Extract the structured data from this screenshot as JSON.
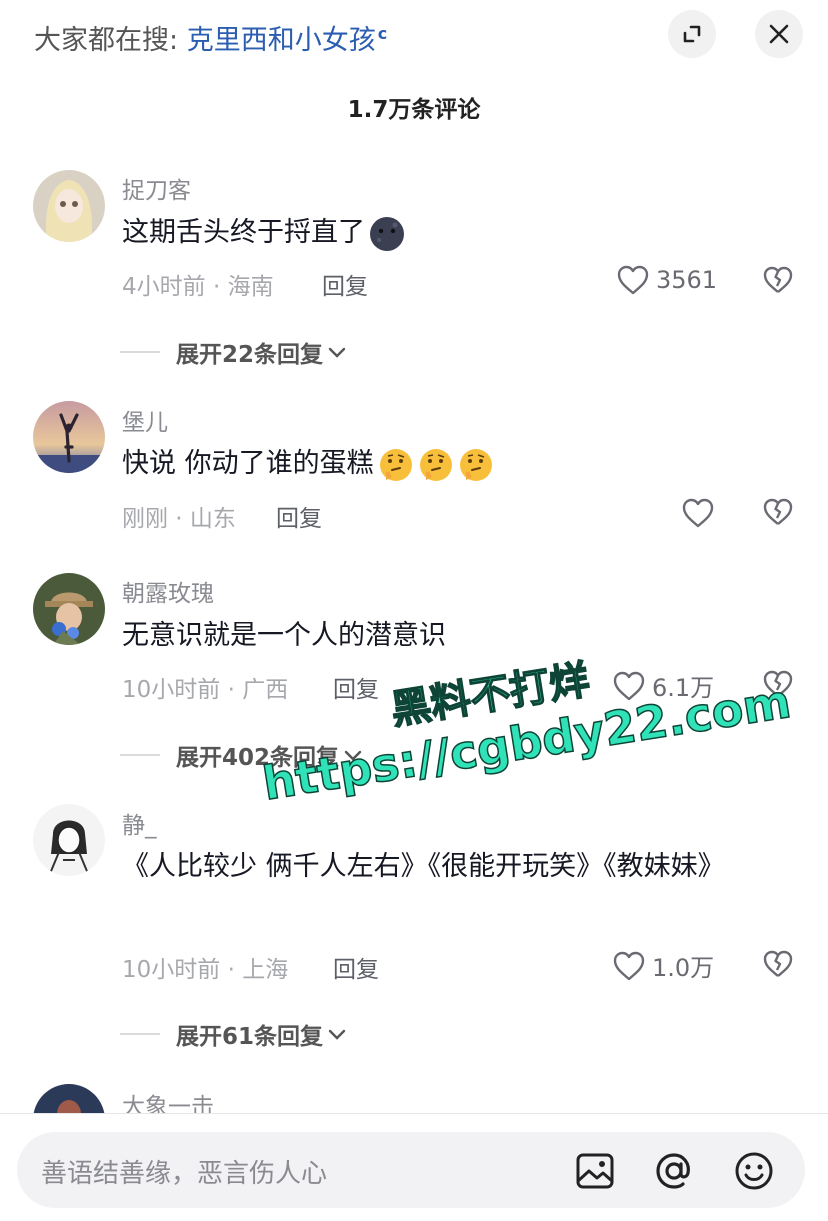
{
  "header": {
    "search_prefix": "大家都在搜:",
    "search_term": "克里西和小女孩",
    "search_glyph": "ᴽ"
  },
  "comment_count": "1.7万条评论",
  "comments": [
    {
      "username": "捉刀客",
      "text": "这期舌头终于捋直了",
      "meta": "4小时前 · 海南",
      "reply": "回复",
      "likes": "3561",
      "expand": "展开22条回复",
      "emoji": "dark-moon-face"
    },
    {
      "username": "堡儿",
      "text": "快说 你动了谁的蛋糕",
      "meta": "刚刚 · 山东",
      "reply": "回复",
      "likes": "",
      "emoji": "thinking-face"
    },
    {
      "username": "朝露玫瑰",
      "text": "无意识就是一个人的潜意识",
      "meta": "10小时前 · 广西",
      "reply": "回复",
      "likes": "6.1万",
      "expand": "展开402条回复"
    },
    {
      "username": "静_",
      "text": "《人比较少 俩千人左右》《很能开玩笑》《教妹妹》",
      "meta": "10小时前 · 上海",
      "reply": "回复",
      "likes": "1.0万",
      "expand": "展开61条回复"
    },
    {
      "username": "大象一击"
    }
  ],
  "watermark": {
    "line1": "黑料不打烊",
    "line2": "https://cgbdy22.com"
  },
  "input": {
    "placeholder": "善语结善缘，恶言伤人心"
  },
  "icons": {
    "expand": "expand-icon",
    "close": "close-icon",
    "like": "heart-icon",
    "dislike": "broken-heart-icon",
    "image": "image-icon",
    "mention": "at-icon",
    "emoji": "smiley-icon"
  }
}
